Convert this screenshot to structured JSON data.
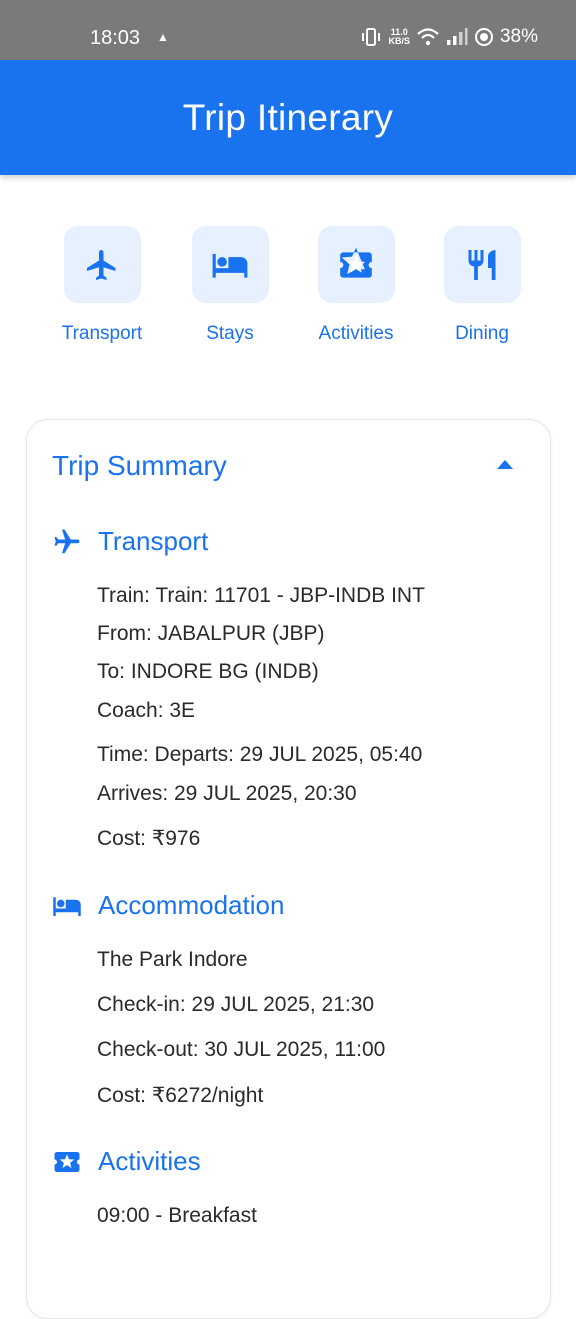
{
  "status_bar": {
    "time": "18:03",
    "net_speed_value": "11.0",
    "net_speed_unit": "KB/S",
    "battery": "38%"
  },
  "app_bar": {
    "title": "Trip Itinerary"
  },
  "categories": [
    {
      "label": "Transport",
      "icon": "airplane-icon"
    },
    {
      "label": "Stays",
      "icon": "bed-icon"
    },
    {
      "label": "Activities",
      "icon": "ticket-icon"
    },
    {
      "label": "Dining",
      "icon": "fork-knife-icon"
    }
  ],
  "summary": {
    "title": "Trip Summary",
    "transport": {
      "heading": "Transport",
      "train": "Train: Train: 11701 - JBP-INDB INT",
      "from": "From: JABALPUR (JBP)",
      "to": "To: INDORE BG (INDB)",
      "coach": "Coach: 3E",
      "departs": "Time: Departs: 29 JUL 2025, 05:40",
      "arrives": "Arrives: 29 JUL 2025, 20:30",
      "cost": "Cost: ₹976"
    },
    "accommodation": {
      "heading": "Accommodation",
      "name": "The Park Indore",
      "checkin": "Check-in: 29 JUL 2025, 21:30",
      "checkout": "Check-out: 30 JUL 2025, 11:00",
      "cost": "Cost: ₹6272/night"
    },
    "activities": {
      "heading": "Activities",
      "first": "09:00 - Breakfast"
    }
  },
  "colors": {
    "primary": "#1a73ee",
    "tile_bg": "#e6f0fe",
    "status_bar": "#7a7a7a"
  }
}
